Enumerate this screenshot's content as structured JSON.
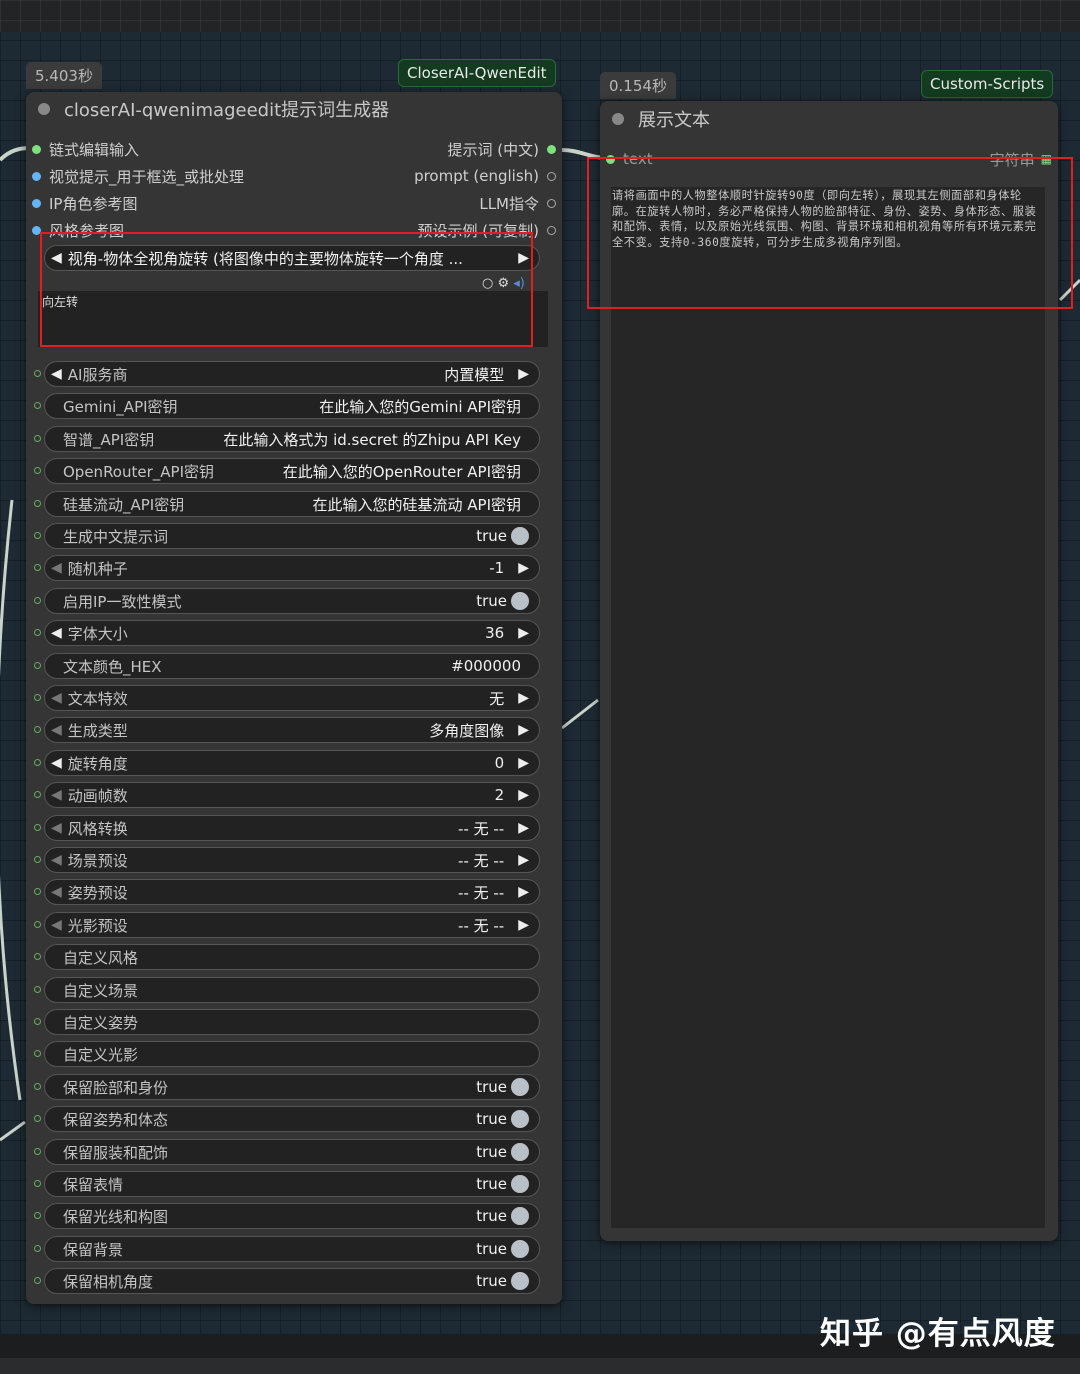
{
  "left_node": {
    "time": "5.403秒",
    "tag": "CloserAI-QwenEdit",
    "title": "closerAI-qwenimageedit提示词生成器",
    "inputs": [
      "链式编辑输入",
      "视觉提示_用于框选_或批处理",
      "IP角色参考图",
      "风格参考图"
    ],
    "outputs": [
      "提示词 (中文)",
      "prompt (english)",
      "LLM指令",
      "预设示例 (可复制)"
    ],
    "preset_combo": "视角-物体全视角旋转 (将图像中的主要物体旋转一个角度 ...",
    "preset_text": "向左转",
    "widgets": [
      {
        "label": "AI服务商",
        "value": "内置模型",
        "kind": "combo"
      },
      {
        "label": "Gemini_API密钥",
        "value": "在此输入您的Gemini API密钥",
        "kind": "text"
      },
      {
        "label": "智谱_API密钥",
        "value": "在此输入格式为 id.secret 的Zhipu API Key",
        "kind": "text"
      },
      {
        "label": "OpenRouter_API密钥",
        "value": "在此输入您的OpenRouter API密钥",
        "kind": "text"
      },
      {
        "label": "硅基流动_API密钥",
        "value": "在此输入您的硅基流动 API密钥",
        "kind": "text"
      },
      {
        "label": "生成中文提示词",
        "value": "true",
        "kind": "toggle"
      },
      {
        "label": "随机种子",
        "value": "-1",
        "kind": "number"
      },
      {
        "label": "启用IP一致性模式",
        "value": "true",
        "kind": "toggle"
      },
      {
        "label": "字体大小",
        "value": "36",
        "kind": "combo"
      },
      {
        "label": "文本颜色_HEX",
        "value": "#000000",
        "kind": "text"
      },
      {
        "label": "文本特效",
        "value": "无",
        "kind": "number"
      },
      {
        "label": "生成类型",
        "value": "多角度图像",
        "kind": "number"
      },
      {
        "label": "旋转角度",
        "value": "0",
        "kind": "combo"
      },
      {
        "label": "动画帧数",
        "value": "2",
        "kind": "number"
      },
      {
        "label": "风格转换",
        "value": "-- 无 --",
        "kind": "number"
      },
      {
        "label": "场景预设",
        "value": "-- 无 --",
        "kind": "number"
      },
      {
        "label": "姿势预设",
        "value": "-- 无 --",
        "kind": "number"
      },
      {
        "label": "光影预设",
        "value": "-- 无 --",
        "kind": "number"
      },
      {
        "label": "自定义风格",
        "value": "",
        "kind": "text"
      },
      {
        "label": "自定义场景",
        "value": "",
        "kind": "text"
      },
      {
        "label": "自定义姿势",
        "value": "",
        "kind": "text"
      },
      {
        "label": "自定义光影",
        "value": "",
        "kind": "text"
      },
      {
        "label": "保留脸部和身份",
        "value": "true",
        "kind": "toggle"
      },
      {
        "label": "保留姿势和体态",
        "value": "true",
        "kind": "toggle"
      },
      {
        "label": "保留服装和配饰",
        "value": "true",
        "kind": "toggle"
      },
      {
        "label": "保留表情",
        "value": "true",
        "kind": "toggle"
      },
      {
        "label": "保留光线和构图",
        "value": "true",
        "kind": "toggle"
      },
      {
        "label": "保留背景",
        "value": "true",
        "kind": "toggle"
      },
      {
        "label": "保留相机角度",
        "value": "true",
        "kind": "toggle"
      }
    ]
  },
  "right_node": {
    "time": "0.154秒",
    "tag": "Custom-Scripts",
    "title": "展示文本",
    "input_label": "text",
    "output_label": "字符串",
    "output_text": "请将画面中的人物整体顺时针旋转90度（即向左转），展现其左侧面部和身体轮廓。在旋转人物时，务必严格保持人物的脸部特征、身份、姿势、身体形态、服装和配饰、表情，以及原始光线氛围、构图、背景环境和相机视角等所有环境元素完全不变。支持0-360度旋转，可分步生成多视角序列图。"
  },
  "watermark": "知乎 @有点风度",
  "colors": {
    "tag_bg": "#123b1f",
    "highlight": "#e02020",
    "node_bg": "#353535"
  }
}
